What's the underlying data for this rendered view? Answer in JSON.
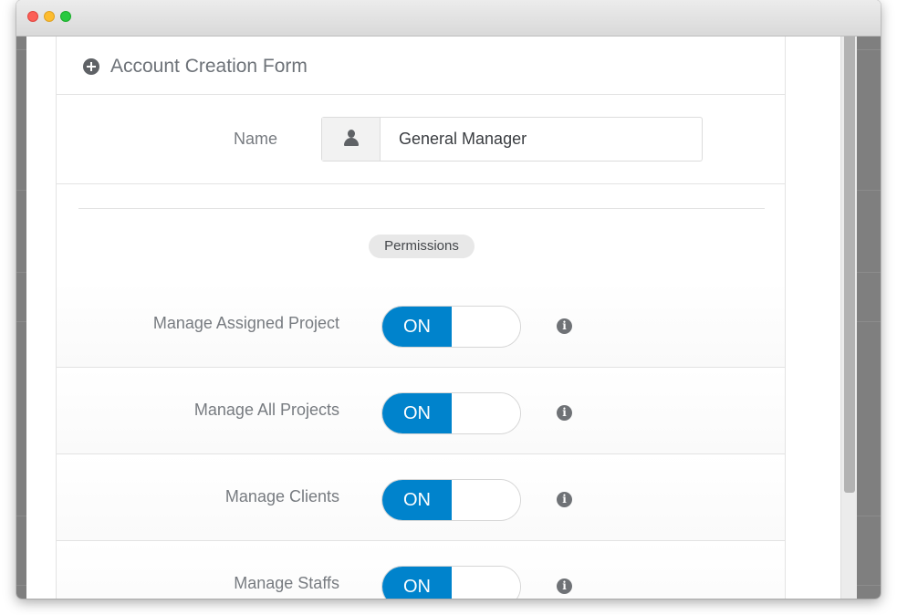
{
  "form": {
    "title": "Account Creation Form",
    "name_label": "Name",
    "name_value": "General Manager",
    "permissions_label": "Permissions"
  },
  "permissions": [
    {
      "label": "Manage Assigned Project",
      "state": "ON"
    },
    {
      "label": "Manage All Projects",
      "state": "ON"
    },
    {
      "label": "Manage Clients",
      "state": "ON"
    },
    {
      "label": "Manage Staffs",
      "state": "ON"
    }
  ],
  "colors": {
    "toggle_on": "#0083cc",
    "icon": "#5f6266"
  },
  "icons": [
    "plus-circle-icon",
    "user-icon",
    "info-icon"
  ]
}
